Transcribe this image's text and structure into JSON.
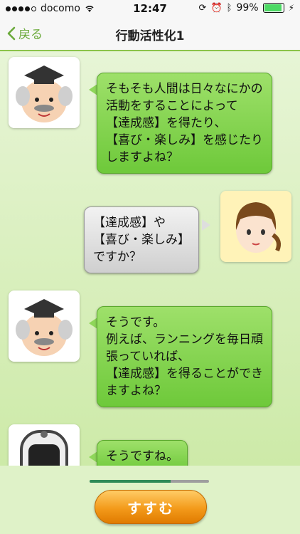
{
  "status_bar": {
    "carrier": "docomo",
    "time": "12:47",
    "battery_percent": "99%",
    "battery_level": 0.99
  },
  "nav": {
    "back_label": "戻る",
    "title": "行動活性化1"
  },
  "messages": [
    {
      "speaker": "professor",
      "side": "left",
      "text": "そもそも人間は日々なにかの\n活動をすることによって\n【達成感】を得たり、\n【喜び・楽しみ】を感じたり\nしますよね？"
    },
    {
      "speaker": "girl",
      "side": "right",
      "text": "【達成感】や\n【喜び・楽しみ】\nですか？"
    },
    {
      "speaker": "professor",
      "side": "left",
      "text": "そうです。\n例えば、ランニングを毎日頑\n張っていれば、\n【達成感】を得ることができ\nますよね？"
    },
    {
      "speaker": "robot",
      "side": "left",
      "text": "そうですね。"
    }
  ],
  "progress": {
    "fraction": 0.68
  },
  "colors": {
    "accent": "#8bc34a",
    "button": "#f39a1a",
    "progress": "#2e8b57"
  },
  "button": {
    "label": "すすむ"
  }
}
